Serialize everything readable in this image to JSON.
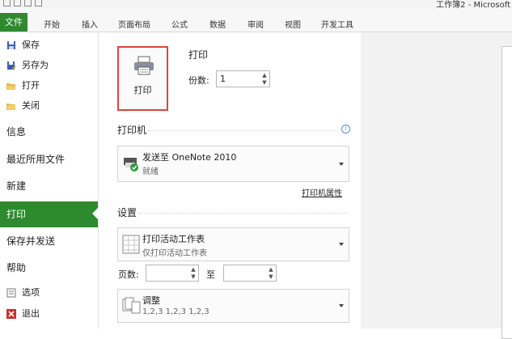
{
  "window": {
    "title": "工作簿2 - Microsoft"
  },
  "ribbon": {
    "file_tab": "文件",
    "tabs": [
      "开始",
      "插入",
      "页面布局",
      "公式",
      "数据",
      "审阅",
      "视图",
      "开发工具"
    ]
  },
  "nav": {
    "save": "保存",
    "save_as": "另存为",
    "open": "打开",
    "close": "关闭",
    "info": "信息",
    "recent": "最近所用文件",
    "new": "新建",
    "print": "打印",
    "save_send": "保存并发送",
    "help": "帮助",
    "options": "选项",
    "exit": "退出"
  },
  "print": {
    "heading": "打印",
    "button_label": "打印",
    "copies_label": "份数:",
    "copies_value": "1"
  },
  "printer": {
    "heading": "打印机",
    "name": "发送至 OneNote 2010",
    "status": "就绪",
    "properties_link": "打印机属性"
  },
  "settings": {
    "heading": "设置",
    "scope_main": "打印活动工作表",
    "scope_sub": "仅打印活动工作表",
    "pages_label": "页数:",
    "pages_from": "",
    "to_label": "至",
    "pages_to": "",
    "collate_main": "调整",
    "collate_sub": "1,2,3    1,2,3    1,2,3"
  },
  "colors": {
    "accent_green": "#2d8a2d",
    "highlight_red": "#d9463f"
  }
}
